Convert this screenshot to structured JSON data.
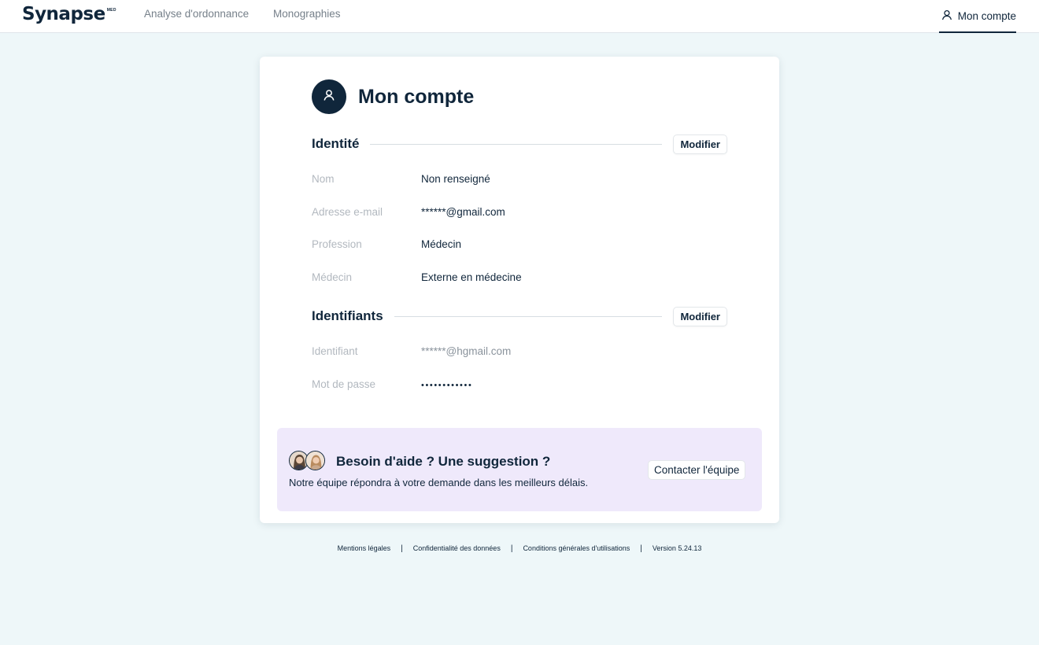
{
  "nav": {
    "logo_text": "Synapse",
    "logo_superscript": "MED",
    "links": [
      "Analyse d'ordonnance",
      "Monographies"
    ],
    "account_label": "Mon compte"
  },
  "page": {
    "title": "Mon compte"
  },
  "identity": {
    "title": "Identité",
    "modify_label": "Modifier",
    "rows": [
      {
        "label": "Nom",
        "value": "Non renseigné"
      },
      {
        "label": "Adresse e-mail",
        "value": "******@gmail.com"
      },
      {
        "label": "Profession",
        "value": "Médecin"
      },
      {
        "label": "Médecin",
        "value": "Externe en médecine"
      }
    ]
  },
  "credentials": {
    "title": "Identifiants",
    "modify_label": "Modifier",
    "rows": [
      {
        "label": "Identifiant",
        "value": "******@hgmail.com"
      },
      {
        "label": "Mot de passe",
        "value": "••••••••••••"
      }
    ]
  },
  "help": {
    "title": "Besoin d'aide ? Une suggestion ?",
    "subtitle": "Notre équipe répondra à votre demande dans les meilleurs délais.",
    "contact_label": "Contacter l'équipe"
  },
  "footer": {
    "links": [
      "Mentions légales",
      "Confidentialité des données",
      "Conditions générales d'utilisations",
      "Version 5.24.13"
    ]
  },
  "colors": {
    "navy": "#10263b",
    "background": "#eef7f9",
    "help_background": "#efe9fb",
    "label_gray": "#b2b8bf"
  },
  "icons": {
    "account": "user-icon",
    "help_avatars": [
      "team-member-avatar",
      "team-member-avatar"
    ]
  }
}
